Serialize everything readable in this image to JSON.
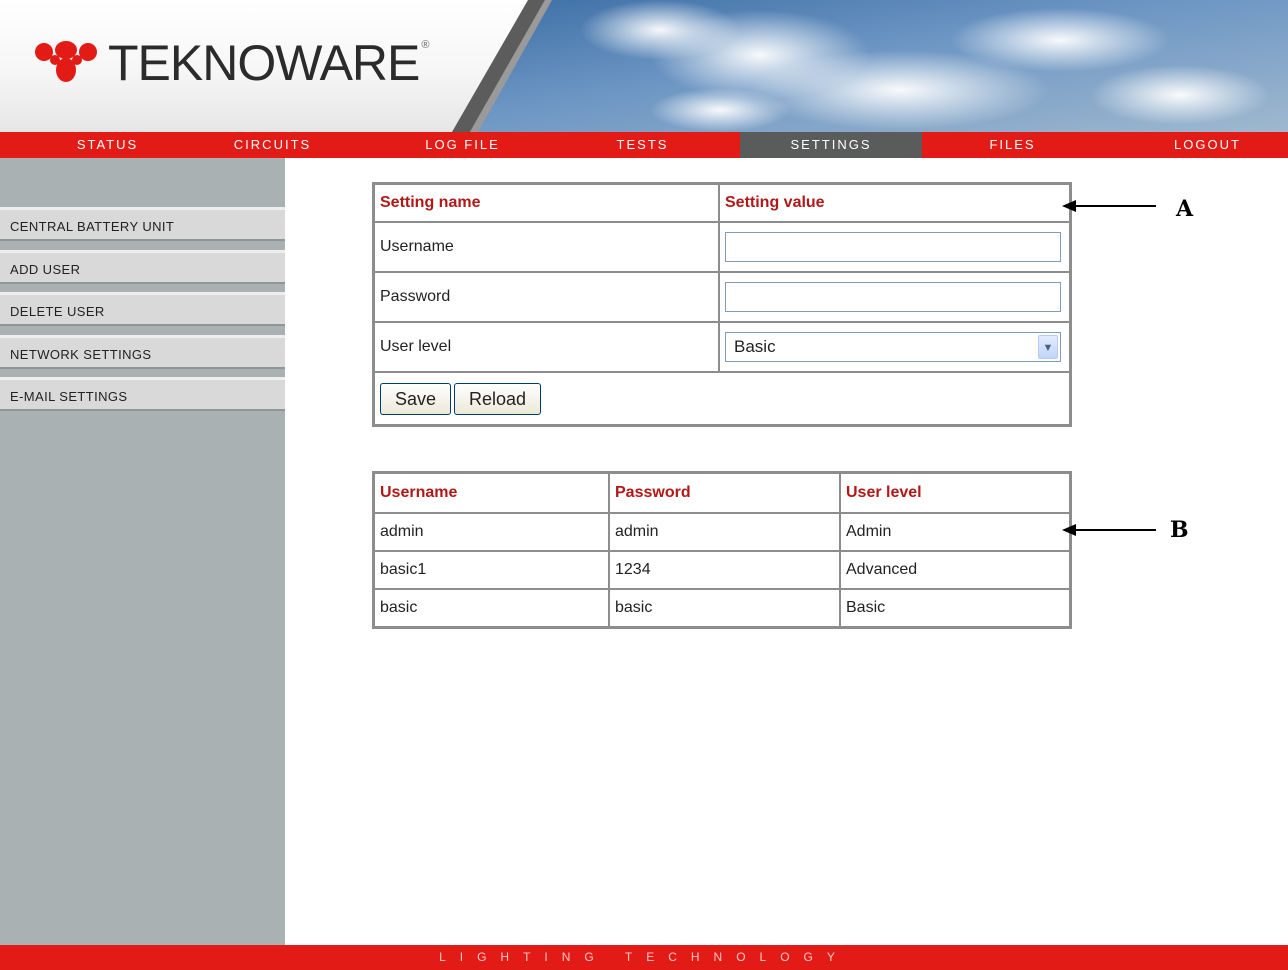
{
  "brand": {
    "name": "TEKNOWARE",
    "reg_mark": "®"
  },
  "topnav": [
    {
      "label": "STATUS"
    },
    {
      "label": "CIRCUITS"
    },
    {
      "label": "LOG FILE"
    },
    {
      "label": "TESTS"
    },
    {
      "label": "SETTINGS",
      "active": true
    },
    {
      "label": "FILES"
    },
    {
      "label": "LOGOUT"
    }
  ],
  "sidebar": {
    "items": [
      {
        "label": "CENTRAL BATTERY UNIT"
      },
      {
        "label": "ADD USER"
      },
      {
        "label": "DELETE USER"
      },
      {
        "label": "NETWORK SETTINGS"
      },
      {
        "label": "E-MAIL SETTINGS"
      }
    ]
  },
  "settings_form": {
    "header_name": "Setting name",
    "header_value": "Setting value",
    "rows": {
      "username_label": "Username",
      "username_value": "",
      "password_label": "Password",
      "password_value": "",
      "user_level_label": "User level",
      "user_level_selected": "Basic"
    },
    "save_label": "Save",
    "reload_label": "Reload"
  },
  "users_table": {
    "headers": [
      "Username",
      "Password",
      "User level"
    ],
    "rows": [
      [
        "admin",
        "admin",
        "Admin"
      ],
      [
        "basic1",
        "1234",
        "Advanced"
      ],
      [
        "basic",
        "basic",
        "Basic"
      ]
    ]
  },
  "annotations": {
    "a": "A",
    "b": "B"
  },
  "footer": {
    "tagline": "LIGHTING TECHNOLOGY"
  },
  "colors": {
    "accent_red": "#e21b17",
    "header_red": "#b21818",
    "sidebar_gray": "#a9b1b2",
    "active_nav": "#5a5c5c"
  }
}
